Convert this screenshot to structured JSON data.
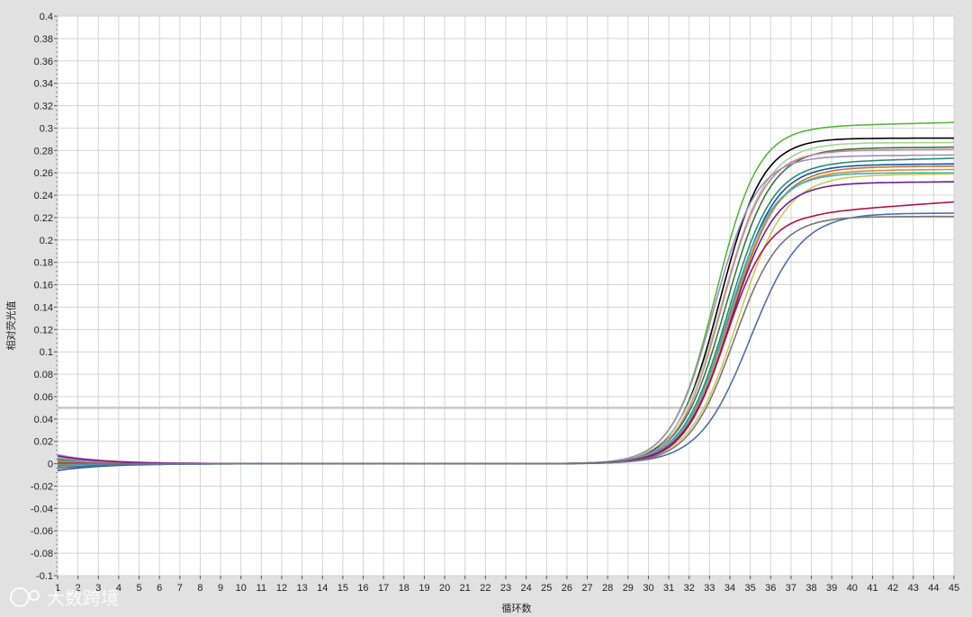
{
  "chart_data": {
    "type": "line",
    "title": "",
    "xlabel": "循环数",
    "ylabel": "相对荧光值",
    "xlim": [
      1,
      45
    ],
    "ylim": [
      -0.1,
      0.4
    ],
    "x_ticks": [
      1,
      2,
      3,
      4,
      5,
      6,
      7,
      8,
      9,
      10,
      11,
      12,
      13,
      14,
      15,
      16,
      17,
      18,
      19,
      20,
      21,
      22,
      23,
      24,
      25,
      26,
      27,
      28,
      29,
      30,
      31,
      32,
      33,
      34,
      35,
      36,
      37,
      38,
      39,
      40,
      41,
      42,
      43,
      44,
      45
    ],
    "y_ticks": [
      -0.1,
      -0.08,
      -0.06,
      -0.04,
      -0.02,
      0,
      0.02,
      0.04,
      0.06,
      0.08,
      0.1,
      0.12,
      0.14,
      0.16,
      0.18,
      0.2,
      0.22,
      0.24,
      0.26,
      0.28,
      0.3,
      0.32,
      0.34,
      0.36,
      0.38,
      0.4
    ],
    "y_tick_labels": [
      "-0.1",
      "-0.08",
      "-0.06",
      "-0.04",
      "-0.02",
      "0",
      "0.02",
      "0.04",
      "0.06",
      "0.08",
      "0.1",
      "0.12",
      "0.14",
      "0.16",
      "0.18",
      "0.2",
      "0.22",
      "0.24",
      "0.26",
      "0.28",
      "0.3",
      "0.32",
      "0.34",
      "0.36",
      "0.38",
      "0.4"
    ],
    "grid": true,
    "threshold": 0.05,
    "threshold_color": "#c8c8c8",
    "curve_model": {
      "plateau": "amplitude",
      "midpoint": "x0",
      "slope": "k",
      "start": "y1",
      "end": "y45"
    },
    "series": [
      {
        "color": "#56b83c",
        "params": {
          "amplitude": 0.302,
          "x0": 33.3,
          "k": 0.95,
          "y1": 0.004,
          "y45": 0.305
        }
      },
      {
        "color": "#000000",
        "params": {
          "amplitude": 0.291,
          "x0": 33.5,
          "k": 0.95,
          "y1": 0.002,
          "y45": 0.291
        }
      },
      {
        "color": "#a6d38a",
        "params": {
          "amplitude": 0.287,
          "x0": 33.6,
          "k": 0.9,
          "y1": 0.006,
          "y45": 0.287
        }
      },
      {
        "color": "#2e7d32",
        "params": {
          "amplitude": 0.282,
          "x0": 33.8,
          "k": 0.9,
          "y1": 0.003,
          "y45": 0.283
        }
      },
      {
        "color": "#d87aa6",
        "params": {
          "amplitude": 0.28,
          "x0": 33.6,
          "k": 0.95,
          "y1": 0.008,
          "y45": 0.281
        }
      },
      {
        "color": "#9c8fbf",
        "params": {
          "amplitude": 0.275,
          "x0": 33.2,
          "k": 0.95,
          "y1": 0.005,
          "y45": 0.276
        }
      },
      {
        "color": "#2a8c7a",
        "params": {
          "amplitude": 0.27,
          "x0": 33.9,
          "k": 0.9,
          "y1": -0.002,
          "y45": 0.273
        }
      },
      {
        "color": "#1f4fa0",
        "params": {
          "amplitude": 0.267,
          "x0": 34.0,
          "k": 0.9,
          "y1": -0.006,
          "y45": 0.268
        }
      },
      {
        "color": "#b07a3a",
        "params": {
          "amplitude": 0.265,
          "x0": 34.1,
          "k": 0.88,
          "y1": 0.001,
          "y45": 0.266
        }
      },
      {
        "color": "#e08a2e",
        "params": {
          "amplitude": 0.262,
          "x0": 34.0,
          "k": 0.88,
          "y1": -0.003,
          "y45": 0.263
        }
      },
      {
        "color": "#36b3c4",
        "params": {
          "amplitude": 0.26,
          "x0": 33.9,
          "k": 0.9,
          "y1": -0.001,
          "y45": 0.26
        }
      },
      {
        "color": "#c9c95a",
        "params": {
          "amplitude": 0.258,
          "x0": 34.4,
          "k": 0.85,
          "y1": 0.002,
          "y45": 0.259
        }
      },
      {
        "color": "#6a1fa0",
        "params": {
          "amplitude": 0.251,
          "x0": 34.0,
          "k": 0.9,
          "y1": 0.007,
          "y45": 0.252
        }
      },
      {
        "color": "#b0134a",
        "params": {
          "amplitude": 0.225,
          "x0": 33.8,
          "k": 0.95,
          "y1": 0.001,
          "y45": 0.234
        }
      },
      {
        "color": "#4a6fb0",
        "params": {
          "amplitude": 0.224,
          "x0": 35.0,
          "k": 0.8,
          "y1": -0.004,
          "y45": 0.224
        }
      },
      {
        "color": "#777777",
        "params": {
          "amplitude": 0.221,
          "x0": 34.2,
          "k": 0.9,
          "y1": 0.0,
          "y45": 0.221
        }
      }
    ]
  },
  "watermark": {
    "text": "大数跨境"
  }
}
